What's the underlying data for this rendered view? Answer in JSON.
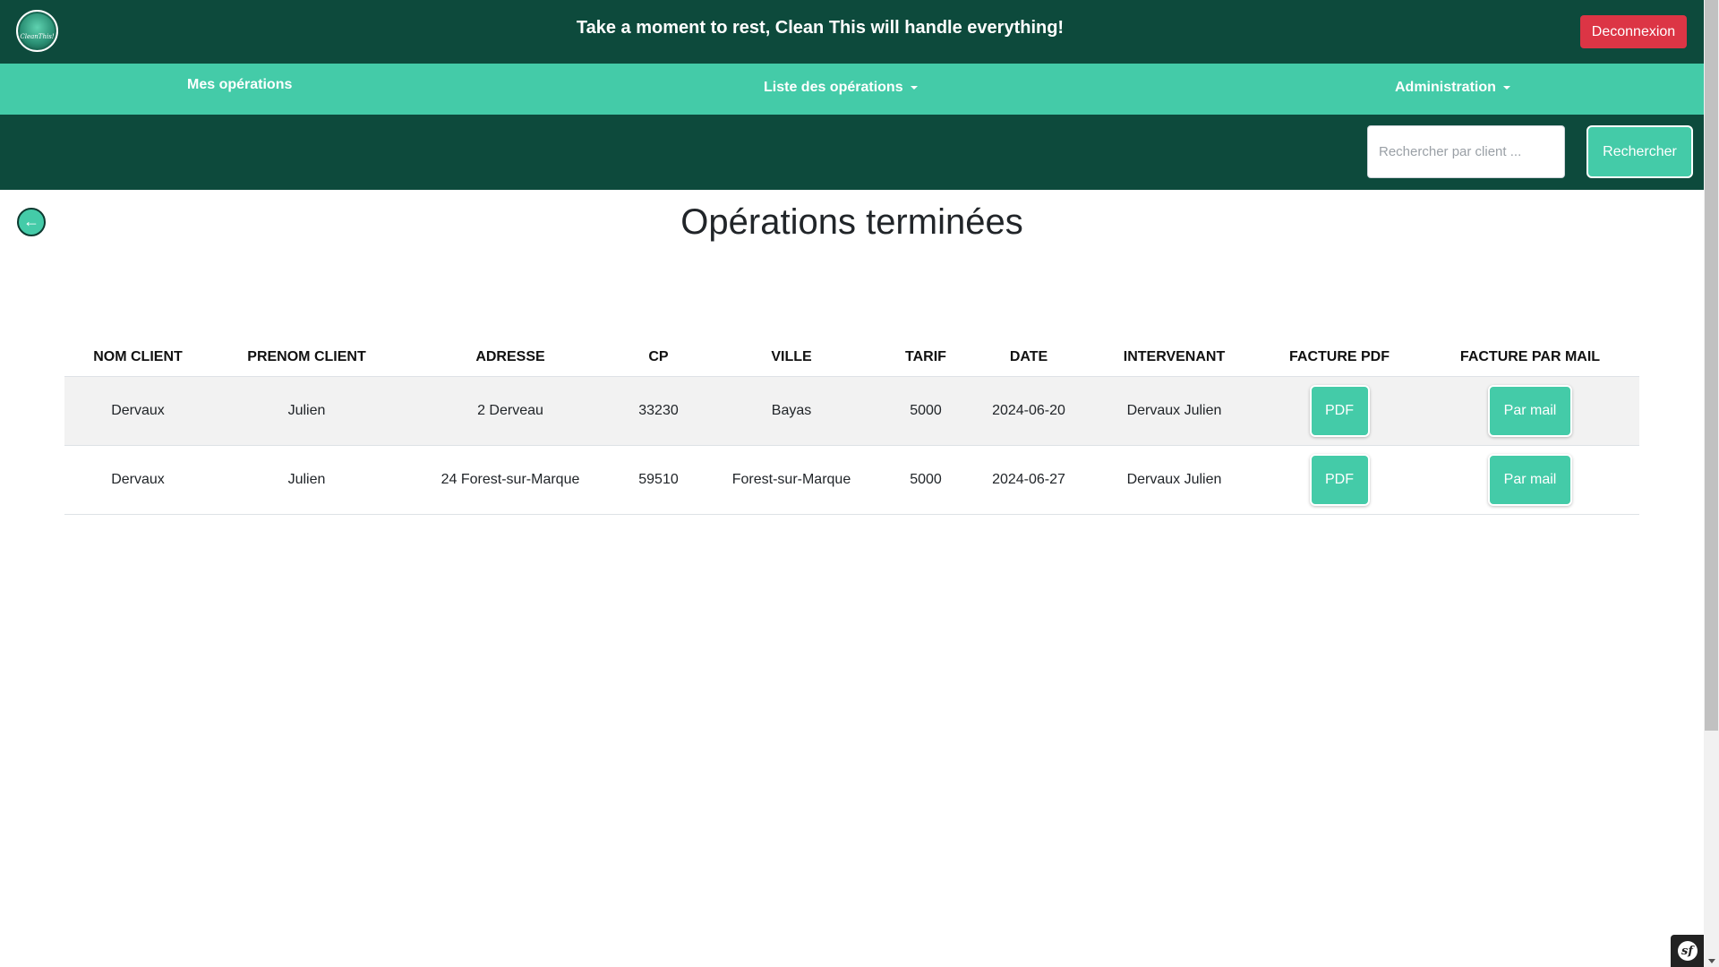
{
  "header": {
    "logo_text": "CleanThis!",
    "tagline": "Take a moment to rest, Clean This will handle everything!",
    "logout_label": "Deconnexion"
  },
  "nav": {
    "mes_operations": "Mes opérations",
    "liste_operations": "Liste des opérations",
    "administration": "Administration"
  },
  "search": {
    "placeholder": "Rechercher par client ...",
    "value": "",
    "button_label": "Rechercher"
  },
  "back": {
    "glyph": "←"
  },
  "page": {
    "title": "Opérations terminées"
  },
  "table": {
    "headers": {
      "nom": "NOM CLIENT",
      "prenom": "PRENOM CLIENT",
      "adresse": "ADRESSE",
      "cp": "CP",
      "ville": "VILLE",
      "tarif": "TARIF",
      "date": "DATE",
      "intervenant": "INTERVENANT",
      "facture_pdf": "FACTURE PDF",
      "facture_mail": "FACTURE PAR MAIL"
    },
    "rows": [
      {
        "nom": "Dervaux",
        "prenom": "Julien",
        "adresse": "2 Derveau",
        "cp": "33230",
        "ville": "Bayas",
        "tarif": "5000",
        "date": "2024-06-20",
        "intervenant": "Dervaux Julien",
        "pdf_label": "PDF",
        "mail_label": "Par mail"
      },
      {
        "nom": "Dervaux",
        "prenom": "Julien",
        "adresse": "24 Forest-sur-Marque",
        "cp": "59510",
        "ville": "Forest-sur-Marque",
        "tarif": "5000",
        "date": "2024-06-27",
        "intervenant": "Dervaux Julien",
        "pdf_label": "PDF",
        "mail_label": "Par mail"
      }
    ]
  },
  "symfony": {
    "icon": "symfony-icon",
    "glyph": "sf"
  },
  "colors": {
    "dark_green": "#0d4a3c",
    "accent_green": "#44cba8",
    "danger_red": "#dc3545"
  }
}
